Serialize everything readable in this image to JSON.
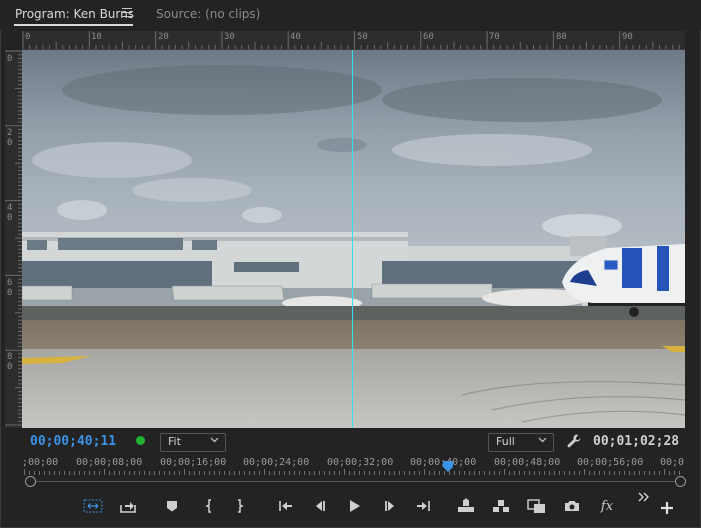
{
  "tabs": {
    "program_label": "Program: Ken Burns",
    "source_label": "Source: (no clips)"
  },
  "ruler": {
    "h_labels": [
      "0",
      "10",
      "20",
      "30",
      "40",
      "50",
      "60",
      "70",
      "80",
      "90"
    ],
    "v_labels": [
      "0",
      "20",
      "40",
      "60",
      "80"
    ]
  },
  "controls": {
    "current_timecode": "00;00;40;11",
    "zoom_select": "Fit",
    "resolution_select": "Full",
    "duration_timecode": "00;01;02;28"
  },
  "timeline": {
    "labels": [
      ";00;00",
      "00;00;08;00",
      "00;00;16;00",
      "00;00;24;00",
      "00;00;32;00",
      "00;00;40;00",
      "00;00;48;00",
      "00;00;56;00",
      "00;0"
    ],
    "playhead_fraction": 0.65
  },
  "transport": {
    "fx_label": "fx"
  },
  "colors": {
    "timecode_blue": "#3b92e6",
    "guide_cyan": "#34e0ea",
    "record_green": "#1fb232"
  }
}
